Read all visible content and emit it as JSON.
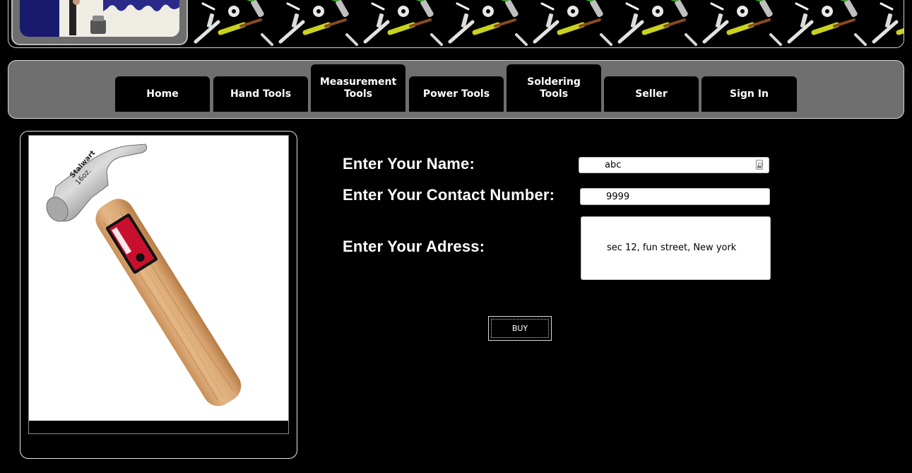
{
  "nav": {
    "items": [
      {
        "label": "Home"
      },
      {
        "label": "Hand Tools"
      },
      {
        "label": "Measurement\nTools"
      },
      {
        "label": "Power Tools"
      },
      {
        "label": "Soldering\nTools"
      },
      {
        "label": "Seller"
      },
      {
        "label": "Sign In"
      }
    ]
  },
  "product": {
    "brand": "Stalwart",
    "size": "16oz.",
    "icon": "claw-hammer-image"
  },
  "form": {
    "name_label": "Enter Your Name:",
    "name_value": "abc",
    "contact_label": "Enter Your Contact Number:",
    "contact_value": "9999",
    "address_label": "Enter Your Adress:",
    "address_value": "sec 12, fun street, New york",
    "buy_label": "BUY"
  },
  "colors": {
    "background": "#000000",
    "nav_bar": "#6f6f6f",
    "nav_button": "#000000",
    "text": "#ffffff",
    "hammer_handle": "#d9a774",
    "label_red": "#c8102e"
  }
}
